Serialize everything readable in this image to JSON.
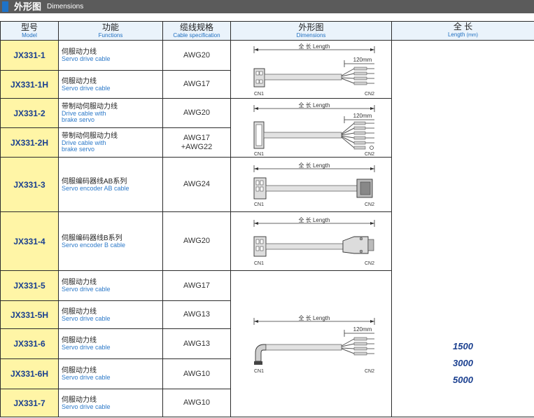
{
  "header": {
    "title_cn": "外形图",
    "title_en": "Dimensions"
  },
  "columns": {
    "model": {
      "cn": "型号",
      "en": "Model"
    },
    "functions": {
      "cn": "功能",
      "en": "Functions"
    },
    "cable_spec": {
      "cn": "缆线规格",
      "en": "Cable specification"
    },
    "dimensions": {
      "cn": "外形图",
      "en": "Dimensions"
    },
    "length": {
      "cn": "全 长",
      "en": "Length",
      "unit": "(mm)"
    }
  },
  "drawing_labels": {
    "length": "全 长  Length",
    "tail": "120mm",
    "cn1": "CN1",
    "cn2": "CN2"
  },
  "rows": [
    {
      "model": "JX331-1",
      "func_cn": "伺服动力线",
      "func_en": "Servo drive cable",
      "spec": "AWG20"
    },
    {
      "model": "JX331-1H",
      "func_cn": "伺服动力线",
      "func_en": "Servo drive cable",
      "spec": "AWG17"
    },
    {
      "model": "JX331-2",
      "func_cn": "带制动伺服动力线",
      "func_en": "Drive cable with",
      "func_en2": "brake servo",
      "spec": "AWG20"
    },
    {
      "model": "JX331-2H",
      "func_cn": "带制动伺服动力线",
      "func_en": "Drive cable with",
      "func_en2": "brake servo",
      "spec": "AWG17",
      "spec2": "+AWG22"
    },
    {
      "model": "JX331-3",
      "func_cn": "伺服编码器线AB系列",
      "func_en": "Servo encoder AB cable",
      "spec": "AWG24"
    },
    {
      "model": "JX331-4",
      "func_cn": "伺服编码器线B系列",
      "func_en": "Servo encoder B cable",
      "spec": "AWG20"
    },
    {
      "model": "JX331-5",
      "func_cn": "伺服动力线",
      "func_en": "Servo drive cable",
      "spec": "AWG17"
    },
    {
      "model": "JX331-5H",
      "func_cn": "伺服动力线",
      "func_en": "Servo drive cable",
      "spec": "AWG13"
    },
    {
      "model": "JX331-6",
      "func_cn": "伺服动力线",
      "func_en": "Servo drive cable",
      "spec": "AWG13"
    },
    {
      "model": "JX331-6H",
      "func_cn": "伺服动力线",
      "func_en": "Servo drive cable",
      "spec": "AWG10"
    },
    {
      "model": "JX331-7",
      "func_cn": "伺服动力线",
      "func_en": "Servo drive cable",
      "spec": "AWG10"
    }
  ],
  "lengths": [
    "1500",
    "3000",
    "5000"
  ]
}
